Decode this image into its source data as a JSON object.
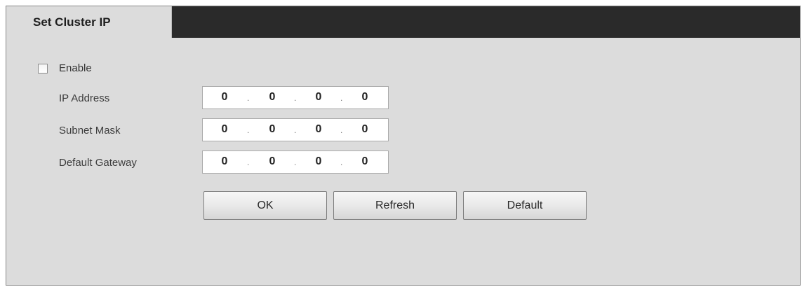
{
  "tab": {
    "label": "Set Cluster IP"
  },
  "enable": {
    "label": "Enable",
    "checked": false
  },
  "fields": [
    {
      "label": "IP Address",
      "octets": [
        "0",
        "0",
        "0",
        "0"
      ]
    },
    {
      "label": "Subnet Mask",
      "octets": [
        "0",
        "0",
        "0",
        "0"
      ]
    },
    {
      "label": "Default Gateway",
      "octets": [
        "0",
        "0",
        "0",
        "0"
      ]
    }
  ],
  "separator": ".",
  "buttons": {
    "ok": "OK",
    "refresh": "Refresh",
    "default": "Default"
  }
}
